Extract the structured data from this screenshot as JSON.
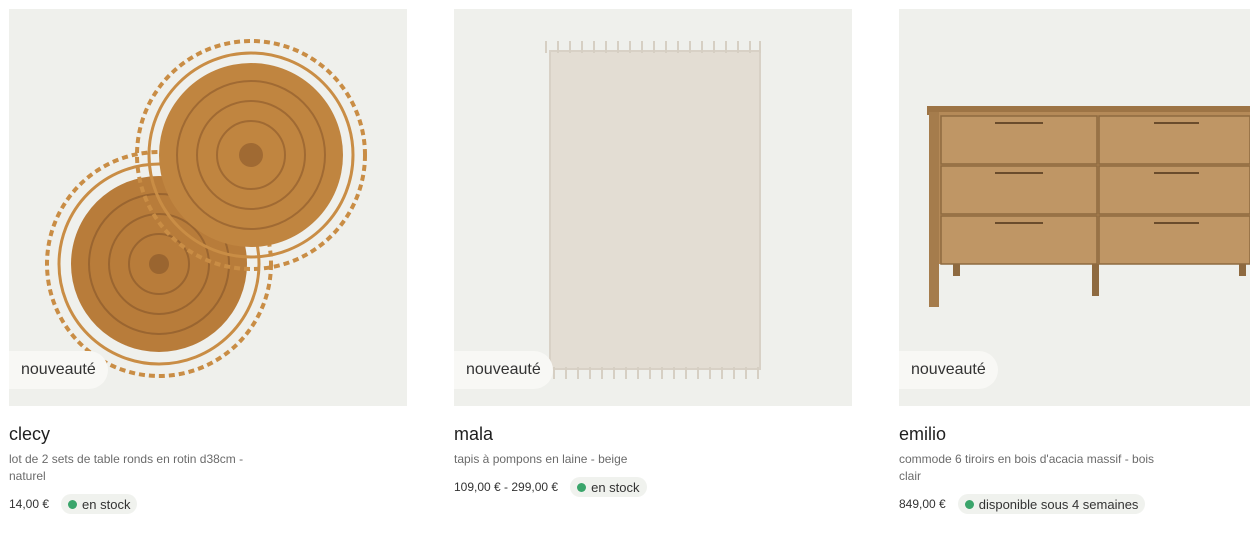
{
  "products": [
    {
      "badge": "nouveauté",
      "name": "clecy",
      "description": "lot de 2 sets de table ronds en rotin d38cm - naturel",
      "price": "14,00 €",
      "availability": "en stock",
      "image": "rattan-placemats-image"
    },
    {
      "badge": "nouveauté",
      "name": "mala",
      "description": "tapis à pompons en laine - beige",
      "price": "109,00 € - 299,00 €",
      "availability": "en stock",
      "image": "wool-rug-image"
    },
    {
      "badge": "nouveauté",
      "name": "emilio",
      "description": "commode 6 tiroirs en bois d'acacia massif - bois clair",
      "price": "849,00 €",
      "availability": "disponible sous 4 semaines",
      "image": "acacia-dresser-image"
    }
  ],
  "colors": {
    "image_bg": "#eff0ec",
    "stock_dot": "#3aa56b",
    "badge_bg": "#f8f8f5"
  }
}
